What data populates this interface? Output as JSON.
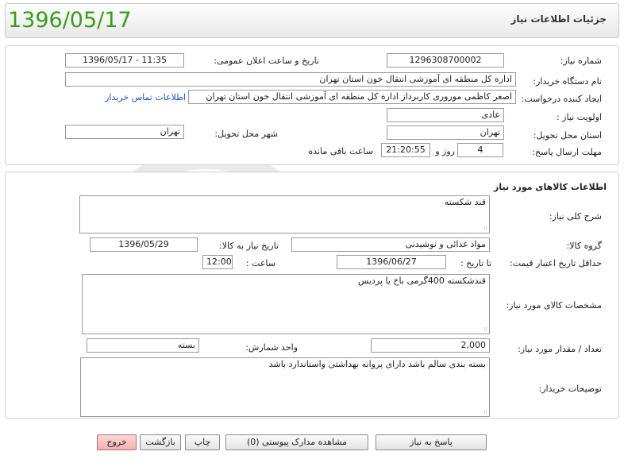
{
  "header": {
    "title": "جزئیات اطلاعات نیاز",
    "date": "1396/05/17"
  },
  "info": {
    "need_number_label": "شماره نیاز:",
    "need_number": "1296308700002",
    "announce_label": "تاریخ و ساعت اعلان عمومی:",
    "announce_value": "1396/05/17 - 11:35",
    "buyer_org_label": "نام دستگاه خریدار:",
    "buyer_org": "اداره کل منطقه ای آموزشی انتقال خون استان تهران",
    "requester_label": "ایجاد کننده درخواست:",
    "requester": "اصغر کاظمی موروری کاربرداز اداره کل منطقه ای آموزشی انتقال خون استان تهران",
    "contact_link": "اطلاعات تماس خریدار",
    "priority_label": "اولویت نیاز :",
    "priority": "عادی",
    "province_label": "استان محل تحویل:",
    "province": "تهران",
    "city_label": "شهر محل تحویل:",
    "city": "تهران",
    "deadline_label": "مهلت ارسال پاسخ:",
    "days": "4",
    "days_and": "روز و",
    "time": "21:20:55",
    "remaining": "ساعت باقی مانده"
  },
  "goods": {
    "section_title": "اطلاعات کالاهای مورد نیاز",
    "summary_label": "شرح کلی نیاز:",
    "summary": "قند شکسته",
    "group_label": "گروه کالا:",
    "group": "مواد غذائی و نوشیدنی",
    "need_date_label": "تاریخ نیاز به کالا:",
    "need_date": "1396/05/29",
    "validity_label": "حداقل تاریخ اعتبار قیمت:",
    "until_label": "تا تاریخ :",
    "validity_date": "1396/06/27",
    "hour_label": "ساعت :",
    "validity_hour": "12:00",
    "spec_label": "مشخصات کالای مورد نیاز:",
    "spec": "قندشکسته 400گرمی باخ یا پردیس",
    "qty_label": "تعداد / مقدار مورد نیاز:",
    "qty": "2,000",
    "unit_label": "واحد شمارش:",
    "unit": "بسته",
    "buyer_notes_label": "توضیحات خریدار:",
    "buyer_notes": "بسته بندی سالم باشد دارای پروانه بهداشتی واستاندارد باشد"
  },
  "buttons": {
    "reply": "پاسخ به نیاز",
    "attachments": "مشاهده مدارک پیوستی (0)",
    "print": "چاپ",
    "back": "بازگشت",
    "exit": "خروج"
  },
  "watermark": {
    "text_big": "هزاره",
    "text_small": "ارتباط گستر"
  }
}
